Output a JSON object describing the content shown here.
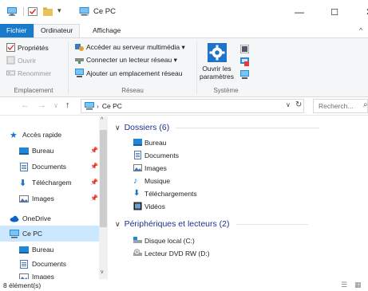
{
  "window": {
    "title": "Ce PC",
    "controls": {
      "minimize": "—",
      "maximize": "☐",
      "close": "✕"
    }
  },
  "ribbon": {
    "tabs": [
      "Fichier",
      "Ordinateur",
      "Affichage"
    ],
    "groups": {
      "emplacement": {
        "label": "Emplacement",
        "items": [
          "Propriétés",
          "Ouvrir",
          "Renommer"
        ]
      },
      "reseau": {
        "label": "Réseau",
        "items": [
          "Accéder au serveur multimédia ▾",
          "Connecter un lecteur réseau ▾",
          "Ajouter un emplacement réseau"
        ]
      },
      "systeme": {
        "label": "Système",
        "open_settings_line1": "Ouvrir les",
        "open_settings_line2": "paramètres"
      }
    }
  },
  "navigation": {
    "address_text": "Ce PC",
    "search_placeholder": "Recherch..."
  },
  "sidebar": {
    "items": [
      {
        "label": "Accès rapide",
        "pinned": false
      },
      {
        "label": "Bureau",
        "pinned": true
      },
      {
        "label": "Documents",
        "pinned": true
      },
      {
        "label": "Téléchargem",
        "pinned": true
      },
      {
        "label": "Images",
        "pinned": true
      },
      {
        "label": "OneDrive",
        "pinned": false
      },
      {
        "label": "Ce PC",
        "pinned": false,
        "selected": true
      },
      {
        "label": "Bureau",
        "pinned": false
      },
      {
        "label": "Documents",
        "pinned": false
      },
      {
        "label": "Images",
        "pinned": false
      }
    ]
  },
  "content": {
    "folders_header": "Dossiers (6)",
    "folders": [
      "Bureau",
      "Documents",
      "Images",
      "Musique",
      "Téléchargements",
      "Vidéos"
    ],
    "devices_header": "Périphériques et lecteurs (2)",
    "devices": [
      "Disque local (C:)",
      "Lecteur DVD RW (D:)"
    ]
  },
  "status": {
    "count": "8 élément(s)"
  },
  "colors": {
    "accent": "#1979ca",
    "selection": "#cce8ff",
    "header_text": "#1e3287"
  }
}
